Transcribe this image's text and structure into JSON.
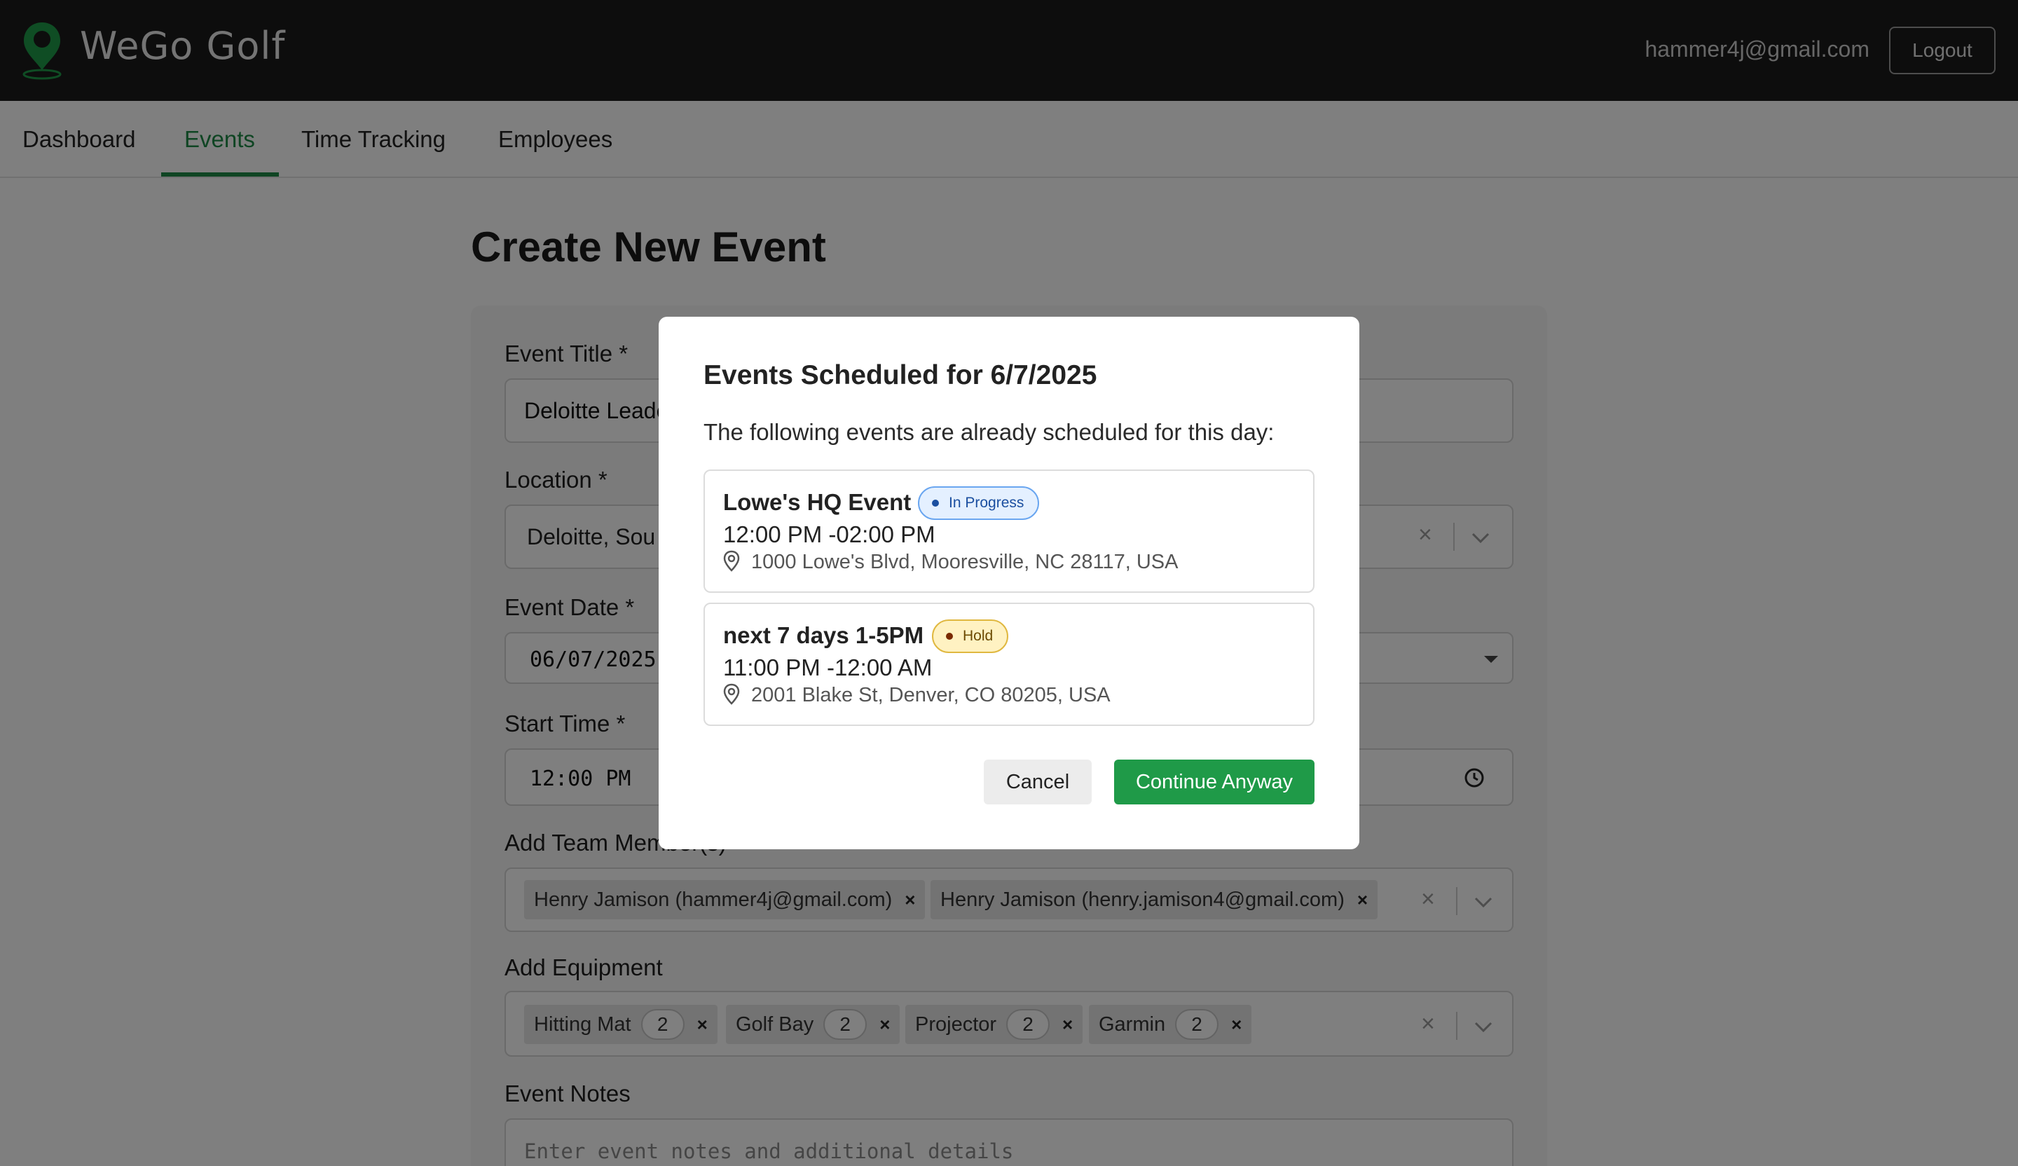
{
  "header": {
    "brand": "WeGo Golf",
    "user_email": "hammer4j@gmail.com",
    "logout_label": "Logout",
    "accent_color": "#1e8a46"
  },
  "nav": {
    "tabs": [
      {
        "label": "Dashboard",
        "active": false
      },
      {
        "label": "Events",
        "active": true
      },
      {
        "label": "Time Tracking",
        "active": false
      },
      {
        "label": "Employees",
        "active": false
      }
    ]
  },
  "page": {
    "title": "Create New Event"
  },
  "form": {
    "event_title": {
      "label": "Event Title *",
      "value": "Deloitte Leade"
    },
    "location": {
      "label": "Location *",
      "value": "Deloitte, Sou"
    },
    "event_date": {
      "label": "Event Date *",
      "value": "06/07/2025"
    },
    "start_time": {
      "label": "Start Time *",
      "value": "12:00 PM"
    },
    "team_members": {
      "label": "Add Team Member(s)",
      "chips": [
        {
          "label": "Henry Jamison (hammer4j@gmail.com)"
        },
        {
          "label": "Henry Jamison (henry.jamison4@gmail.com)"
        }
      ]
    },
    "equipment": {
      "label": "Add Equipment",
      "chips": [
        {
          "label": "Hitting Mat",
          "qty": "2"
        },
        {
          "label": "Golf Bay",
          "qty": "2"
        },
        {
          "label": "Projector",
          "qty": "2"
        },
        {
          "label": "Garmin",
          "qty": "2"
        }
      ]
    },
    "notes": {
      "label": "Event Notes",
      "placeholder": "Enter event notes and additional details"
    },
    "clear_glyph": "×",
    "remove_glyph": "×"
  },
  "modal": {
    "title": "Events Scheduled for 6/7/2025",
    "description": "The following events are already scheduled for this day:",
    "events": [
      {
        "title": "Lowe's HQ Event",
        "status": "In Progress",
        "status_color": "#1b4fa0",
        "time": "12:00 PM -02:00 PM",
        "address": "1000 Lowe's Blvd, Mooresville, NC 28117, USA"
      },
      {
        "title": "next 7 days 1-5PM",
        "status": "Hold",
        "status_color": "#e0b840",
        "time": "11:00 PM -12:00 AM",
        "address": "2001 Blake St, Denver, CO 80205, USA"
      }
    ],
    "cancel_label": "Cancel",
    "continue_label": "Continue Anyway",
    "continue_color": "#1f9a48"
  },
  "icons": {
    "logo": "map-pin-logo-icon",
    "location": "location-pin-icon",
    "clock": "clock-icon",
    "chevron": "chevron-down-icon",
    "caret": "caret-down-icon"
  }
}
